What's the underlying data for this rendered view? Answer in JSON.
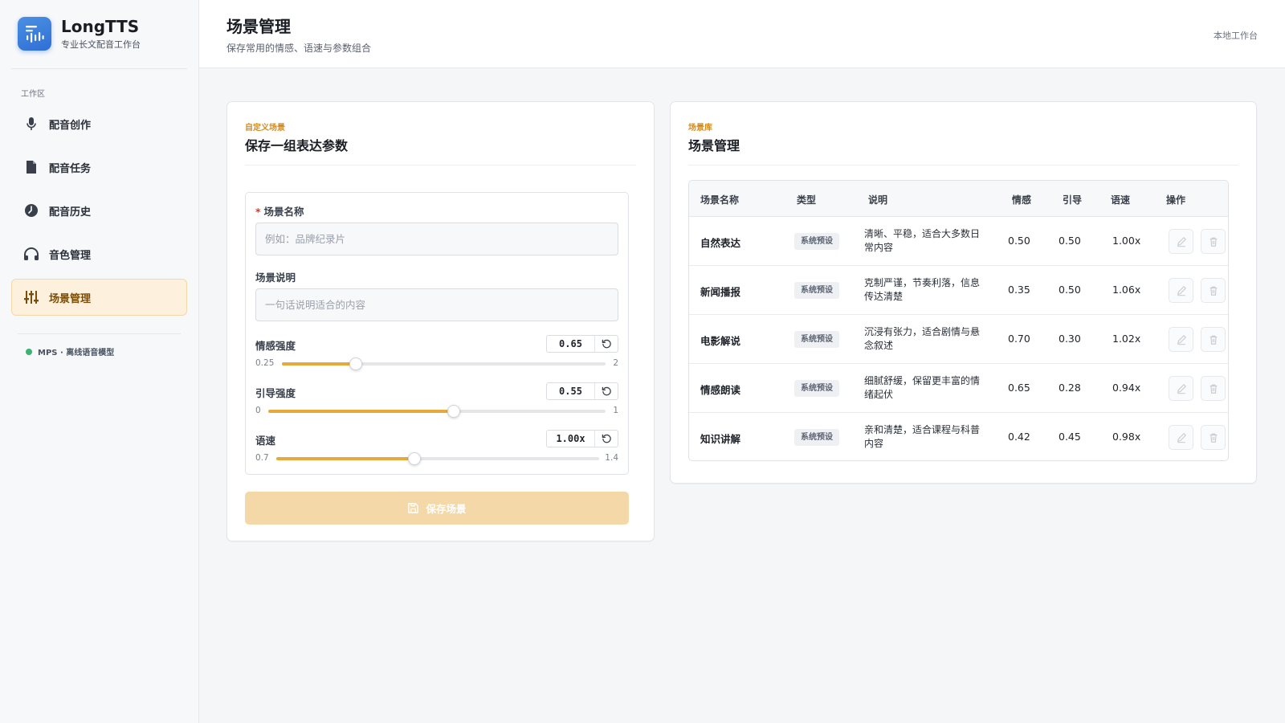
{
  "brand": {
    "name": "LongTTS",
    "subtitle": "专业长文配音工作台"
  },
  "sidebar": {
    "section_label": "工作区",
    "items": [
      {
        "label": "配音创作",
        "icon": "microphone-icon",
        "active": false
      },
      {
        "label": "配音任务",
        "icon": "document-icon",
        "active": false
      },
      {
        "label": "配音历史",
        "icon": "clock-icon",
        "active": false
      },
      {
        "label": "音色管理",
        "icon": "headphones-icon",
        "active": false
      },
      {
        "label": "场景管理",
        "icon": "sliders-icon",
        "active": true
      }
    ],
    "status": {
      "label": "MPS · 离线语音模型",
      "color": "#3cb371"
    }
  },
  "header": {
    "title": "场景管理",
    "subtitle": "保存常用的情感、语速与参数组合",
    "workspace": "本地工作台"
  },
  "form_card": {
    "kicker": "自定义场景",
    "title": "保存一组表达参数",
    "name_label": "场景名称",
    "name_placeholder": "例如：品牌纪录片",
    "name_value": "",
    "desc_label": "场景说明",
    "desc_placeholder": "一句话说明适合的内容",
    "desc_value": "",
    "sliders": [
      {
        "label": "情感强度",
        "display": "0.65",
        "min": 0.25,
        "max": 2,
        "min_label": "0.25",
        "max_label": "2",
        "value": 0.65
      },
      {
        "label": "引导强度",
        "display": "0.55",
        "min": 0,
        "max": 1,
        "min_label": "0",
        "max_label": "1",
        "value": 0.55
      },
      {
        "label": "语速",
        "display": "1.00x",
        "min": 0.7,
        "max": 1.4,
        "min_label": "0.7",
        "max_label": "1.4",
        "value": 1.0
      }
    ],
    "save_label": "保存场景"
  },
  "library_card": {
    "kicker": "场景库",
    "title": "场景管理",
    "columns": [
      "场景名称",
      "类型",
      "说明",
      "情感",
      "引导",
      "语速",
      "操作"
    ],
    "rows": [
      {
        "name": "自然表达",
        "type": "系统预设",
        "desc": "清晰、平稳，适合大多数日常内容",
        "emotion": "0.50",
        "guide": "0.50",
        "speed": "1.00x"
      },
      {
        "name": "新闻播报",
        "type": "系统预设",
        "desc": "克制严谨，节奏利落，信息传达清楚",
        "emotion": "0.35",
        "guide": "0.50",
        "speed": "1.06x"
      },
      {
        "name": "电影解说",
        "type": "系统预设",
        "desc": "沉浸有张力，适合剧情与悬念叙述",
        "emotion": "0.70",
        "guide": "0.30",
        "speed": "1.02x"
      },
      {
        "name": "情感朗读",
        "type": "系统预设",
        "desc": "细腻舒缓，保留更丰富的情绪起伏",
        "emotion": "0.65",
        "guide": "0.28",
        "speed": "0.94x"
      },
      {
        "name": "知识讲解",
        "type": "系统预设",
        "desc": "亲和清楚，适合课程与科普内容",
        "emotion": "0.42",
        "guide": "0.45",
        "speed": "0.98x"
      }
    ]
  },
  "colors": {
    "accent": "#e8a93c",
    "accent_soft": "#f5d8a8",
    "active_bg": "#fdf0dc",
    "brand_blue": "#2f6fd6"
  }
}
